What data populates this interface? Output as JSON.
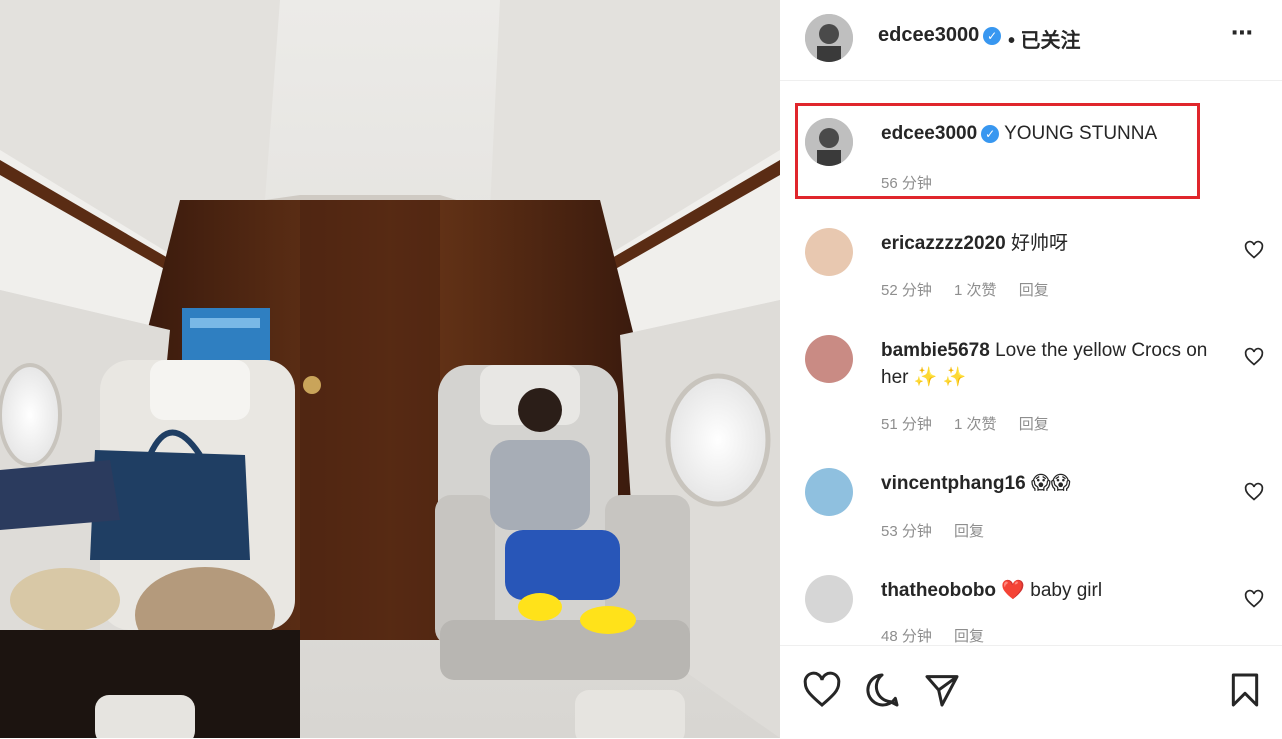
{
  "post": {
    "author": "edcee3000",
    "follow_status": "• 已关注",
    "more_icon": "⋯",
    "caption_text": "YOUNG STUNNA",
    "caption_time": "56 分钟"
  },
  "comments": [
    {
      "user": "ericazzzz2020",
      "text": "好帅呀",
      "time": "52 分钟",
      "likes": "1 次赞",
      "reply": "回复"
    },
    {
      "user": "bambie5678",
      "text": "Love the yellow Crocs on her ✨ ✨",
      "time": "51 分钟",
      "likes": "1 次赞",
      "reply": "回复"
    },
    {
      "user": "vincentphang16",
      "text": "😱😱",
      "time": "53 分钟",
      "likes": "",
      "reply": "回复"
    },
    {
      "user": "thatheobobo",
      "text": "❤️ baby girl",
      "time": "48 分钟",
      "likes": "",
      "reply": "回复"
    }
  ],
  "colors": {
    "highlight_box": "#e0262c",
    "verified": "#3897f0"
  },
  "icons": [
    "heart-icon",
    "comment-icon",
    "share-icon",
    "bookmark-icon"
  ]
}
